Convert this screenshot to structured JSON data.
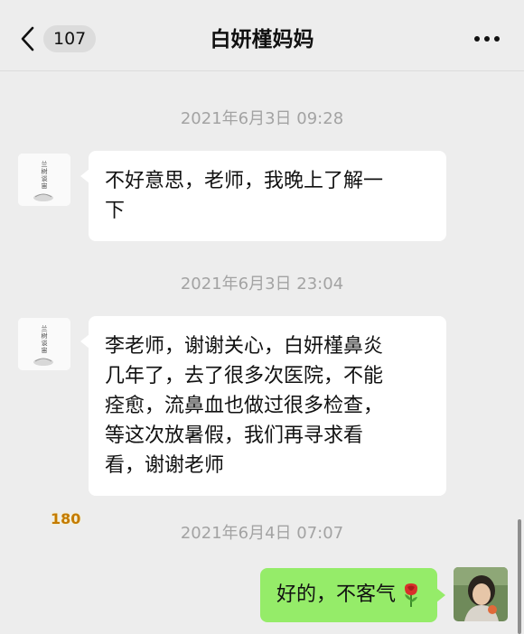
{
  "header": {
    "back_badge": "107",
    "title": "白妍槿妈妈"
  },
  "messages": [
    {
      "time": "2021年6月3日 09:28",
      "side": "left",
      "text_lines": [
        "不好意思，老师，我晚上了解一",
        "下"
      ]
    },
    {
      "time": "2021年6月3日 23:04",
      "side": "left",
      "text_lines": [
        "李老师，谢谢关心，白妍槿鼻炎",
        "几年了，去了很多次医院，不能",
        "痊愈，流鼻血也做过很多检查，",
        "等这次放暑假，我们再寻求看",
        "看，谢谢老师"
      ]
    },
    {
      "time": "2021年6月4日 07:07",
      "side": "right",
      "text": "好的，不客气",
      "emoji": "rose-icon"
    }
  ],
  "overlay_counter": "180",
  "colors": {
    "background": "#ededed",
    "bubble_left": "#ffffff",
    "bubble_right": "#95ec69",
    "timestamp": "#a3a3a3"
  }
}
